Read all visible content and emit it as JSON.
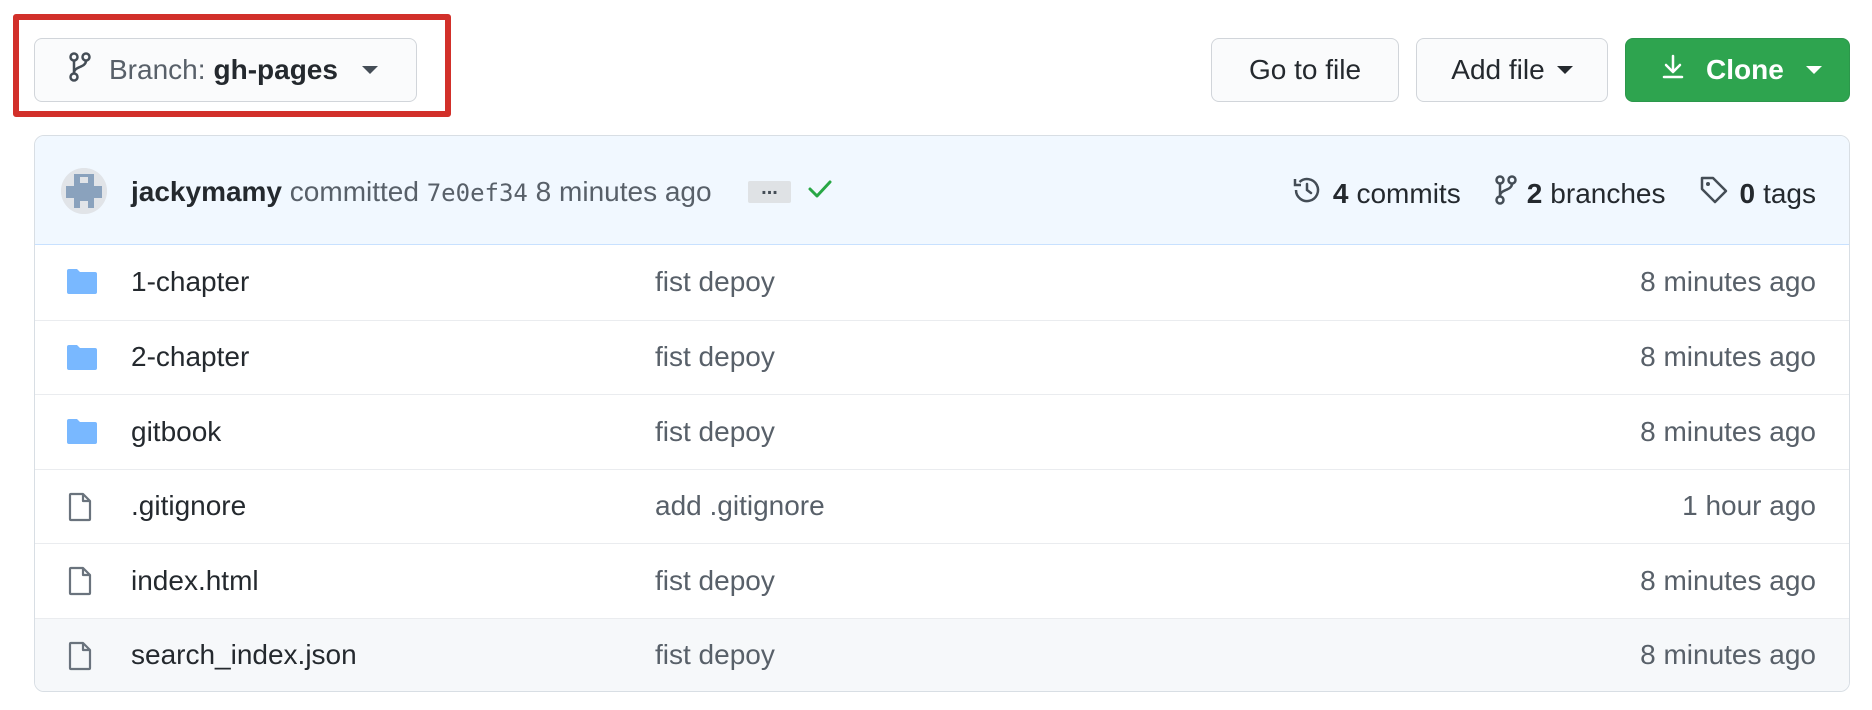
{
  "toolbar": {
    "branch_label": "Branch:",
    "branch_value": "gh-pages",
    "goto_file": "Go to file",
    "add_file": "Add file",
    "clone": "Clone"
  },
  "commit": {
    "author": "jackymamy",
    "verb": "committed",
    "sha": "7e0ef34",
    "time": "8 minutes ago",
    "ellipsis": "..."
  },
  "stats": {
    "commits_count": "4",
    "commits_label": "commits",
    "branches_count": "2",
    "branches_label": "branches",
    "tags_count": "0",
    "tags_label": "tags"
  },
  "files": [
    {
      "type": "folder",
      "name": "1-chapter",
      "message": "fist depoy",
      "age": "8 minutes ago"
    },
    {
      "type": "folder",
      "name": "2-chapter",
      "message": "fist depoy",
      "age": "8 minutes ago"
    },
    {
      "type": "folder",
      "name": "gitbook",
      "message": "fist depoy",
      "age": "8 minutes ago"
    },
    {
      "type": "file",
      "name": ".gitignore",
      "message": "add .gitignore",
      "age": "1 hour ago"
    },
    {
      "type": "file",
      "name": "index.html",
      "message": "fist depoy",
      "age": "8 minutes ago"
    },
    {
      "type": "file",
      "name": "search_index.json",
      "message": "fist depoy",
      "age": "8 minutes ago"
    }
  ],
  "colors": {
    "highlight": "#d2302a",
    "clone_green": "#2ea44f",
    "folder_blue": "#79b8ff",
    "check_green": "#28a745"
  }
}
